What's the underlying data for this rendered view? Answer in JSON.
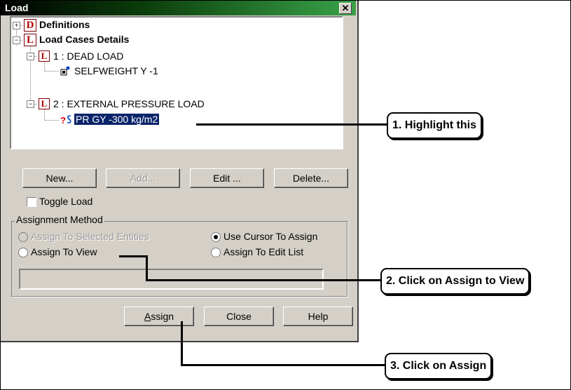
{
  "dialog": {
    "title": "Load",
    "close_glyph": "✕"
  },
  "tree": {
    "definitions": "Definitions",
    "definitions_icon": "D",
    "load_cases": "Load Cases Details",
    "load_cases_icon": "L",
    "case1": "1 : DEAD LOAD",
    "case1_item": "SELFWEIGHT Y -1",
    "case2": "2 : EXTERNAL PRESSURE LOAD",
    "case2_item": "PR GY -300  kg/m2",
    "case_icon": "L",
    "unknown_glyph": "?",
    "expand_plus": "+",
    "collapse_minus": "−"
  },
  "buttons": {
    "new": "New...",
    "add": "Add...",
    "edit": "Edit ...",
    "delete": "Delete...",
    "assign": "Assign",
    "close": "Close",
    "help": "Help"
  },
  "toggle_load": "Toggle Load",
  "assignment": {
    "legend": "Assignment Method",
    "selected_entities": "Assign To Selected Entities",
    "use_cursor": "Use Cursor To Assign",
    "to_view": "Assign To View",
    "to_edit_list": "Assign To Edit List",
    "selected_option": "Use Cursor To Assign"
  },
  "callouts": {
    "step1": "1. Highlight this",
    "step2": "2. Click on Assign to View",
    "step3": "3. Click on Assign"
  }
}
